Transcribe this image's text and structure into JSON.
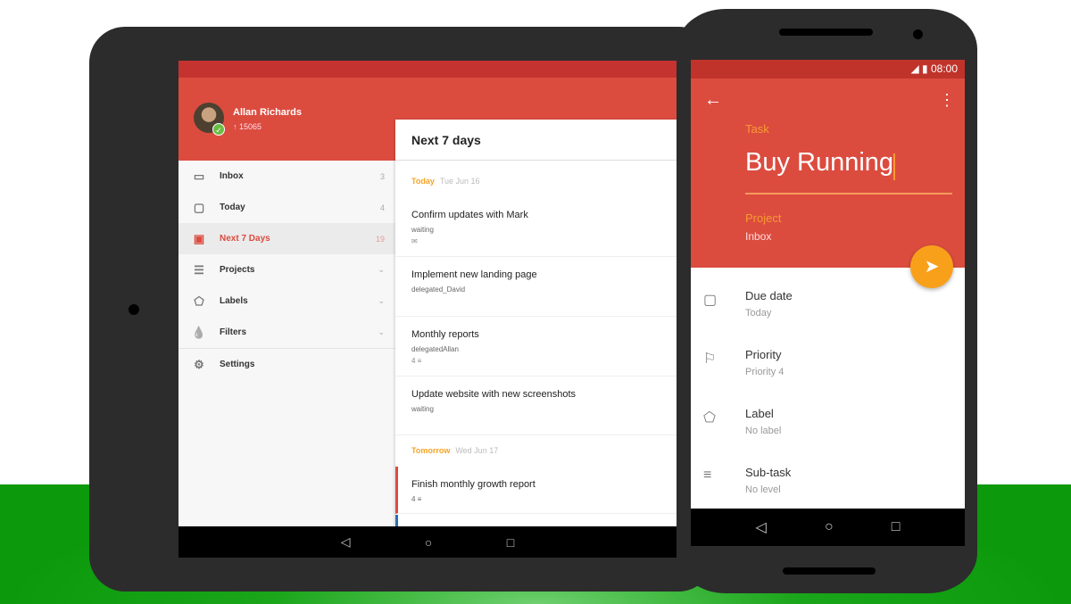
{
  "tablet": {
    "user": {
      "name": "Allan Richards",
      "karma": "↑ 15065"
    },
    "sidebar": [
      {
        "icon": "inbox-icon",
        "glyph": "▭",
        "label": "Inbox",
        "count": "3"
      },
      {
        "icon": "calendar-icon",
        "glyph": "▢",
        "label": "Today",
        "count": "4"
      },
      {
        "icon": "calendar-plus7-icon",
        "glyph": "▣",
        "label": "Next 7 Days",
        "count": "19",
        "active": true
      },
      {
        "icon": "projects-icon",
        "glyph": "☰",
        "label": "Projects",
        "count": "⌄"
      },
      {
        "icon": "label-icon",
        "glyph": "⬠",
        "label": "Labels",
        "count": "⌄"
      },
      {
        "icon": "filter-drop-icon",
        "glyph": "💧",
        "label": "Filters",
        "count": "⌄"
      },
      {
        "icon": "gear-icon",
        "glyph": "⚙",
        "label": "Settings",
        "count": ""
      }
    ],
    "panel": {
      "title": "Next 7 days",
      "today": {
        "label": "Today",
        "date": "Tue Jun 16"
      },
      "tomorrow": {
        "label": "Tomorrow",
        "date": "Wed Jun 17"
      },
      "tasks": [
        {
          "title": "Confirm updates with Mark",
          "sub": "waiting",
          "meta": "✉"
        },
        {
          "title": "Implement new landing page",
          "sub": "delegated_David",
          "meta": ""
        },
        {
          "title": "Monthly reports",
          "sub": "delegatedAllan",
          "meta": "4 ≡"
        },
        {
          "title": "Update website with new screenshots",
          "sub": "waiting",
          "meta": ""
        },
        {
          "title": "Finish monthly growth report",
          "sub": "4 ≡",
          "meta": ""
        }
      ]
    },
    "nav": {
      "back": "◁",
      "home": "○",
      "recent": "□"
    }
  },
  "phone": {
    "status": {
      "time": "08:00",
      "icons": "◢ ▮"
    },
    "back": "←",
    "menu": "⋮",
    "task_label": "Task",
    "task_value": "Buy Running",
    "project_label": "Project",
    "project_value": "Inbox",
    "fab": "➤",
    "rows": [
      {
        "icon": "calendar-icon",
        "glyph": "▢",
        "key": "Due date",
        "value": "Today"
      },
      {
        "icon": "flag-icon",
        "glyph": "⚐",
        "key": "Priority",
        "value": "Priority 4"
      },
      {
        "icon": "label-icon",
        "glyph": "⬠",
        "key": "Label",
        "value": "No label"
      },
      {
        "icon": "subtask-icon",
        "glyph": "≡",
        "key": "Sub-task",
        "value": "No level"
      }
    ],
    "nav": {
      "back": "◁",
      "home": "○",
      "recent": "□"
    }
  },
  "colors": {
    "brand": "#db4c3f",
    "accent": "#f9a01b"
  }
}
